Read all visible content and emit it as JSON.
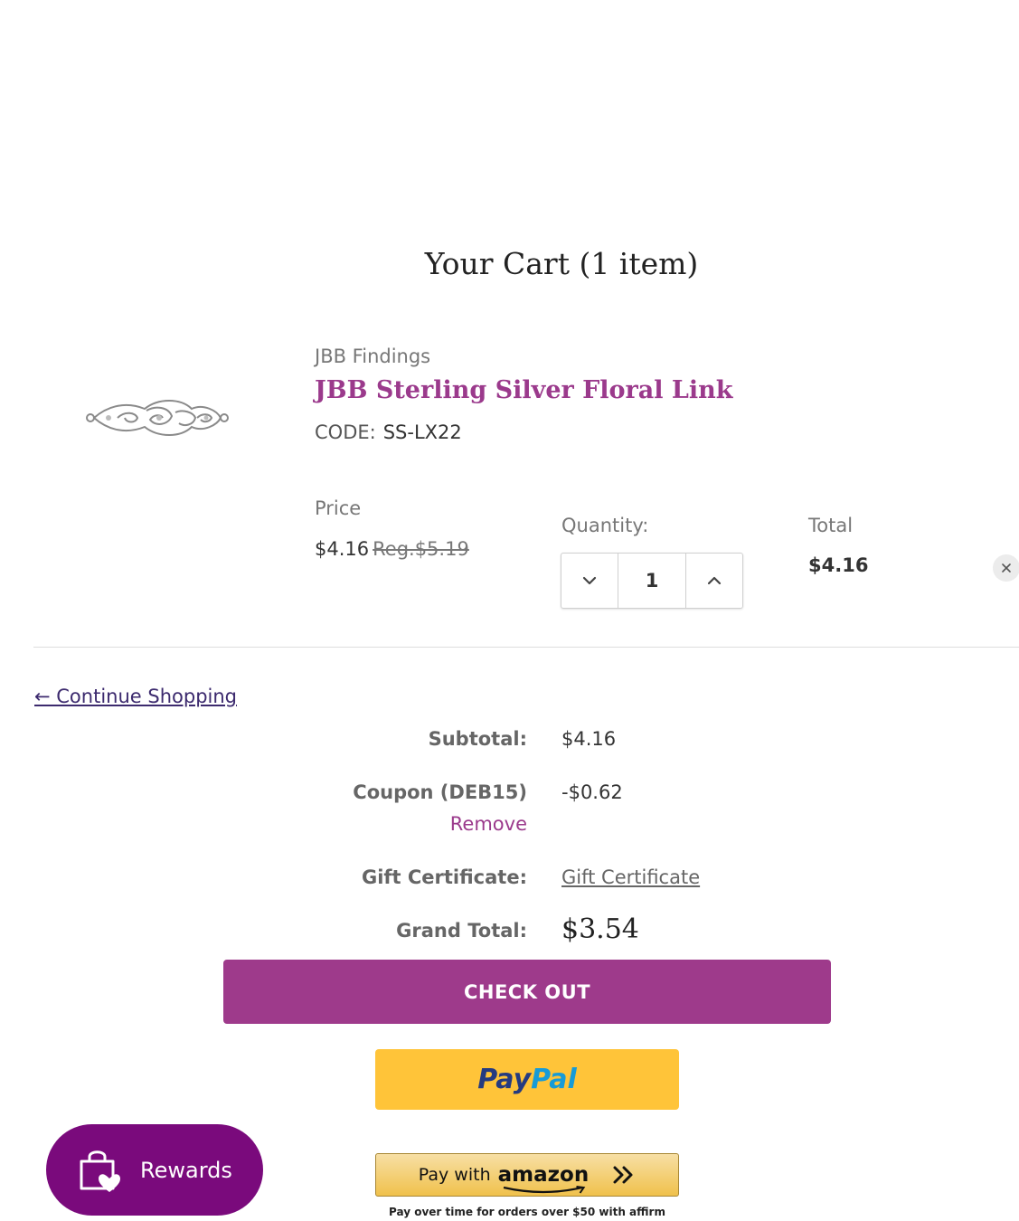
{
  "cart": {
    "title": "Your Cart (1 item)"
  },
  "item": {
    "brand": "JBB Findings",
    "name": "JBB Sterling Silver Floral Link",
    "code_label": "CODE:",
    "code": "SS-LX22",
    "price_label": "Price",
    "price": "$4.16",
    "reg_price": "Reg.$5.19",
    "quantity_label": "Quantity:",
    "quantity": "1",
    "total_label": "Total",
    "total": "$4.16",
    "image_icon": "floral-link-image"
  },
  "continue_shopping": "← Continue Shopping",
  "summary": {
    "subtotal_label": "Subtotal:",
    "subtotal": "$4.16",
    "coupon_label": "Coupon (DEB15)",
    "coupon_value": "-$0.62",
    "coupon_remove": "Remove",
    "gift_label": "Gift Certificate:",
    "gift_link": "Gift Certificate",
    "grand_label": "Grand Total:",
    "grand_total": "$3.54"
  },
  "checkout": {
    "label": "CHECK OUT"
  },
  "paypal": {
    "part1": "Pay",
    "part2": "Pal"
  },
  "amazon": {
    "prefix": "Pay with",
    "logo": "amazon"
  },
  "affirm_note": "Pay over time for orders over $50 with affirm",
  "rewards": {
    "label": "Rewards"
  },
  "colors": {
    "accent": "#9e3a8b",
    "rewards": "#7a0a7c",
    "paypal": "#ffc439"
  }
}
